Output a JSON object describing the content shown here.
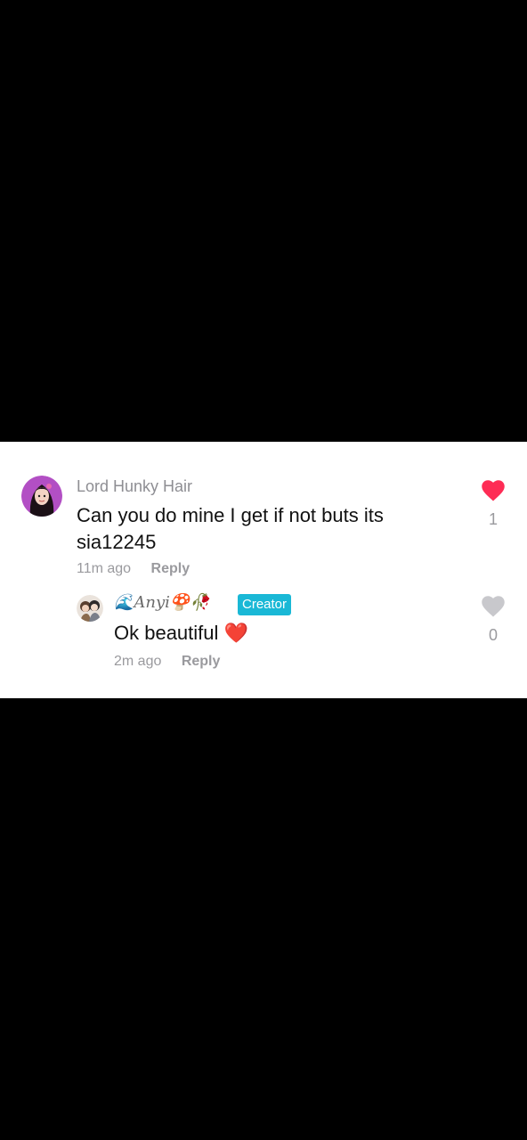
{
  "comment": {
    "username": "Lord Hunky Hair",
    "text": "Can you do mine I get if not buts its sia12245",
    "time": "11m ago",
    "reply_label": "Reply",
    "like_count": "1",
    "liked": true,
    "avatar_icon": "avatar-girl-purple"
  },
  "reply": {
    "username": "🌊Anyi🍄🥀",
    "badge": "Creator",
    "text": "Ok beautiful ❤️",
    "time": "2m ago",
    "reply_label": "Reply",
    "like_count": "0",
    "liked": false,
    "avatar_icon": "avatar-couple"
  },
  "colors": {
    "background": "#000000",
    "panel": "#ffffff",
    "like_active": "#fe2c55",
    "like_inactive": "#c8c8cc",
    "creator_badge": "#1ab8d6"
  }
}
